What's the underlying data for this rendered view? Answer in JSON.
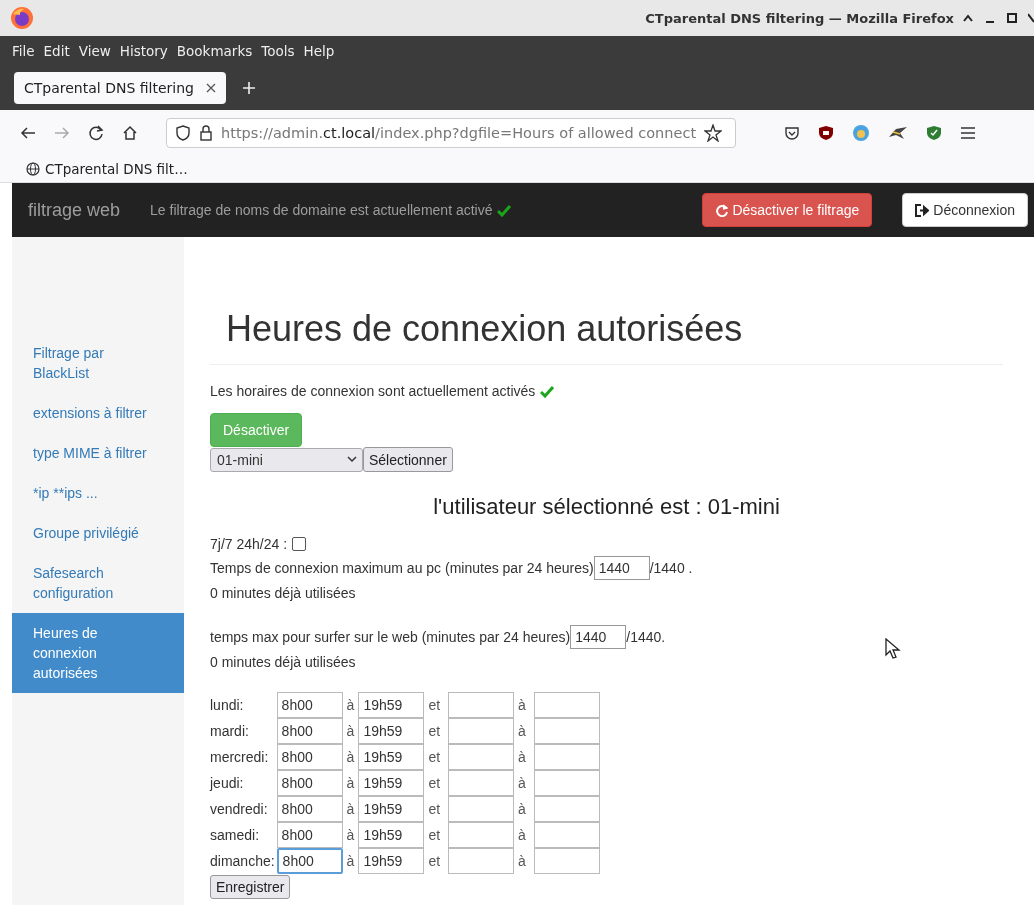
{
  "browser": {
    "window_title": "CTparental DNS filtering — Mozilla Firefox",
    "menu": [
      "File",
      "Edit",
      "View",
      "History",
      "Bookmarks",
      "Tools",
      "Help"
    ],
    "tabs": [
      {
        "label": "CTparental DNS filtering",
        "selected": true
      }
    ],
    "forward_disabled": true,
    "url": {
      "prefix": "https://admin.",
      "domain": "ct.local",
      "path": "/index.php?dgfile=Hours of allowed connect"
    },
    "bookmarks": [
      "CTparental DNS filt…"
    ]
  },
  "navbar": {
    "brand": "filtrage web",
    "status": "Le filtrage de noms de domaine est actuellement activé",
    "status_active": true,
    "disable_button": "Désactiver le filtrage",
    "logout_button": "Déconnexion"
  },
  "sidebar": {
    "items": [
      {
        "label": "Filtrage par BlackList",
        "selected": false
      },
      {
        "label": "extensions à filtrer",
        "selected": false
      },
      {
        "label": "type MIME à filtrer",
        "selected": false
      },
      {
        "label": "*ip **ips ...",
        "selected": false
      },
      {
        "label": "Groupe privilégié",
        "selected": false
      },
      {
        "label": "Safesearch configuration",
        "selected": false
      },
      {
        "label": "Heures de connexion autorisées",
        "selected": true
      }
    ]
  },
  "main": {
    "title": "Heures de connexion autorisées",
    "schedule_status": "Les horaires de connexion sont actuellement activés",
    "schedule_active": true,
    "deactivate_button": "Désactiver",
    "user_select": "01-mini",
    "select_button": "Sélectionner",
    "user_heading": "l'utilisateur sélectionné est : 01-mini",
    "always_label": "7j/7 24h/24 :",
    "always_checked": false,
    "pc_limit": {
      "label": "Temps de connexion maximum au pc (minutes par 24 heures)",
      "value": "1440",
      "total": "/1440 .",
      "used": "0 minutes déjà utilisées"
    },
    "web_limit": {
      "label": "temps max pour surfer sur le web (minutes par 24 heures)",
      "value": "1440",
      "total": "/1440.",
      "used": "0 minutes déjà utilisées"
    },
    "days": [
      {
        "day": "lundi:",
        "from": "8h00",
        "to_word": "à",
        "to": "19h59",
        "and_word": "et",
        "to2_word": "à",
        "focused": false
      },
      {
        "day": "mardi:",
        "from": "8h00",
        "to_word": "à",
        "to": "19h59",
        "and_word": "et",
        "to2_word": "à",
        "focused": false
      },
      {
        "day": "mercredi:",
        "from": "8h00",
        "to_word": "à",
        "to": "19h59",
        "and_word": "et",
        "to2_word": "à",
        "focused": false
      },
      {
        "day": "jeudi:",
        "from": "8h00",
        "to_word": "à",
        "to": "19h59",
        "and_word": "et",
        "to2_word": "à",
        "focused": false
      },
      {
        "day": "vendredi:",
        "from": "8h00",
        "to_word": "à",
        "to": "19h59",
        "and_word": "et",
        "to2_word": "à",
        "focused": false
      },
      {
        "day": "samedi:",
        "from": "8h00",
        "to_word": "à",
        "to": "19h59",
        "and_word": "et",
        "to2_word": "à",
        "focused": false
      },
      {
        "day": "dimanche:",
        "from": "8h00",
        "to_word": "à",
        "to": "19h59",
        "and_word": "et",
        "to2_word": "à",
        "focused": true
      }
    ],
    "save_button": "Enregistrer"
  }
}
